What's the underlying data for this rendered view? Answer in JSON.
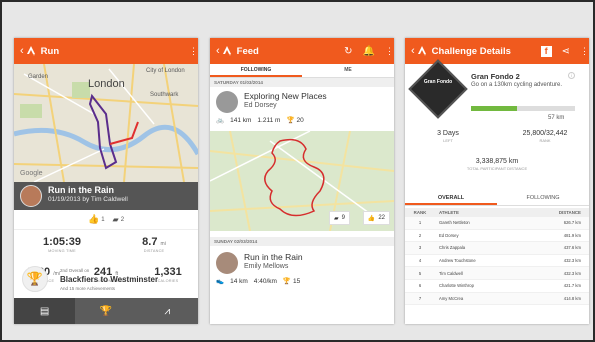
{
  "colors": {
    "accent": "#f05a1e",
    "progress": "#72b93f",
    "dark_bar": "#5c5c5c"
  },
  "run_screen": {
    "title": "Run",
    "map": {
      "labels": [
        "Garden",
        "London",
        "City of London",
        "Southwark",
        "Google"
      ]
    },
    "activity": {
      "title": "Run in the Rain",
      "subtitle": "01/19/2013 by Tim Caldwell"
    },
    "kudos": {
      "count": "1",
      "comments": "2"
    },
    "stats": [
      {
        "value": "1:05:39",
        "unit": "",
        "label": "MOVING TIME"
      },
      {
        "value": "8.7",
        "unit": "mi",
        "label": "DISTANCE"
      },
      {
        "value": "7:30",
        "unit": "/mi",
        "label": "AVG PACE"
      },
      {
        "value": "241",
        "unit": "ft",
        "label": "ELEVATION GAIN"
      },
      {
        "value": "1,331",
        "unit": "",
        "label": "CALORIES"
      }
    ],
    "achievement": {
      "line1": "2nd Overall on",
      "segment": "Blackfiers to Westminster",
      "line3": "And 15 more Achievements"
    }
  },
  "feed_screen": {
    "title": "Feed",
    "tabs": [
      "FOLLOWING",
      "ME"
    ],
    "date1": "SATURDAY 01/03/2014",
    "item1": {
      "title": "Exploring New Places",
      "athlete": "Ed Dorsey",
      "distance": "141 km",
      "elevation": "1.211 m",
      "achievements": "20",
      "comments": "9",
      "kudos": "22"
    },
    "date2": "SUNDAY 02/03/2014",
    "item2": {
      "title": "Run in the Rain",
      "athlete": "Emily Mellows",
      "distance": "14 km",
      "pace": "4:40/km",
      "achievements": "15"
    }
  },
  "challenge_screen": {
    "title": "Challenge Details",
    "badge_text": "Gran Fondo",
    "name": "Gran Fondo 2",
    "description": "Go on a 130km cycling adventure.",
    "progress_fraction": 0.44,
    "progress_km": "57 km",
    "days_left": "3 Days",
    "days_label": "LEFT",
    "rank": "25,800/32,442",
    "rank_label": "RANK",
    "total_distance": "3,338,875 km",
    "total_label": "TOTAL PARTICIPANT DISTANCE",
    "tabs": [
      "OVERALL",
      "FOLLOWING"
    ],
    "leaderboard_headers": [
      "RANK",
      "ATHLETE",
      "DISTANCE"
    ],
    "leaderboard": [
      {
        "rank": "1",
        "athlete": "Gareth Nettleton",
        "distance": "626.7 km"
      },
      {
        "rank": "2",
        "athlete": "Ed Dorsey",
        "distance": "481.9 km"
      },
      {
        "rank": "3",
        "athlete": "Chris Zappala",
        "distance": "437.6 km"
      },
      {
        "rank": "4",
        "athlete": "Andrew Touchstone",
        "distance": "432.3 km"
      },
      {
        "rank": "5",
        "athlete": "Tim Caldwell",
        "distance": "432.3 km"
      },
      {
        "rank": "6",
        "athlete": "Charlotte Winthrop",
        "distance": "421.7 km"
      },
      {
        "rank": "7",
        "athlete": "Amy McCrea",
        "distance": "414.8 km"
      }
    ]
  }
}
